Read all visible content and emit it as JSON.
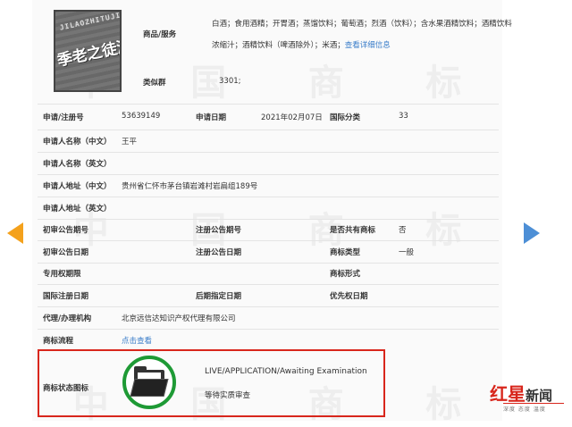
{
  "logo_text": {
    "pinyin": "JILAOZHITUJIU",
    "chinese": "季老之徒酒"
  },
  "goods": {
    "label": "商品/服务",
    "line1": "白酒；食用酒精；开胃酒；蒸馏饮料；葡萄酒；烈酒（饮料）；含水果酒精饮料；酒精饮料",
    "line2_text": "浓缩汁；酒精饮料（啤酒除外）；米酒；",
    "line2_link": "查看详细信息"
  },
  "similar_group": {
    "label": "类似群",
    "value": "3301;"
  },
  "fields": {
    "reg_no_label": "申请/注册号",
    "reg_no": "53639149",
    "app_date_label": "申请日期",
    "app_date": "2021年02月07日",
    "intl_class_label": "国际分类",
    "intl_class": "33",
    "applicant_cn_label": "申请人名称（中文）",
    "applicant_cn": "王平",
    "applicant_en_label": "申请人名称（英文）",
    "address_cn_label": "申请人地址（中文）",
    "address_cn": "贵州省仁怀市茅台镇岩滩村岩扁组189号",
    "address_en_label": "申请人地址（英文）",
    "prelim_pub_no_label": "初审公告期号",
    "reg_pub_no_label": "注册公告期号",
    "shared_label": "是否共有商标",
    "shared": "否",
    "prelim_pub_date_label": "初审公告日期",
    "reg_pub_date_label": "注册公告日期",
    "mark_type_label": "商标类型",
    "mark_type": "一般",
    "exclusive_period_label": "专用权期限",
    "mark_form_label": "商标形式",
    "intl_reg_date_label": "国际注册日期",
    "later_designation_label": "后期指定日期",
    "priority_date_label": "优先权日期",
    "agent_label": "代理/办理机构",
    "agent": "北京远信达知识产权代理有限公司",
    "process_label": "商标流程",
    "process_link": "点击查看"
  },
  "status": {
    "label": "商标状态图标",
    "english": "LIVE/APPLICATION/Awaiting Examination",
    "chinese": "等待实质审查"
  },
  "brand": {
    "red": "红星",
    "black": "新闻",
    "sub": "深度 态度 温度"
  },
  "watermark_chars": [
    "中",
    "国",
    "商",
    "标"
  ],
  "colors": {
    "accent_red": "#d8261c",
    "link_blue": "#3a7dc9",
    "status_green": "#1e9a35",
    "arrow_orange": "#f4a11c",
    "arrow_blue": "#4d8fd6"
  }
}
